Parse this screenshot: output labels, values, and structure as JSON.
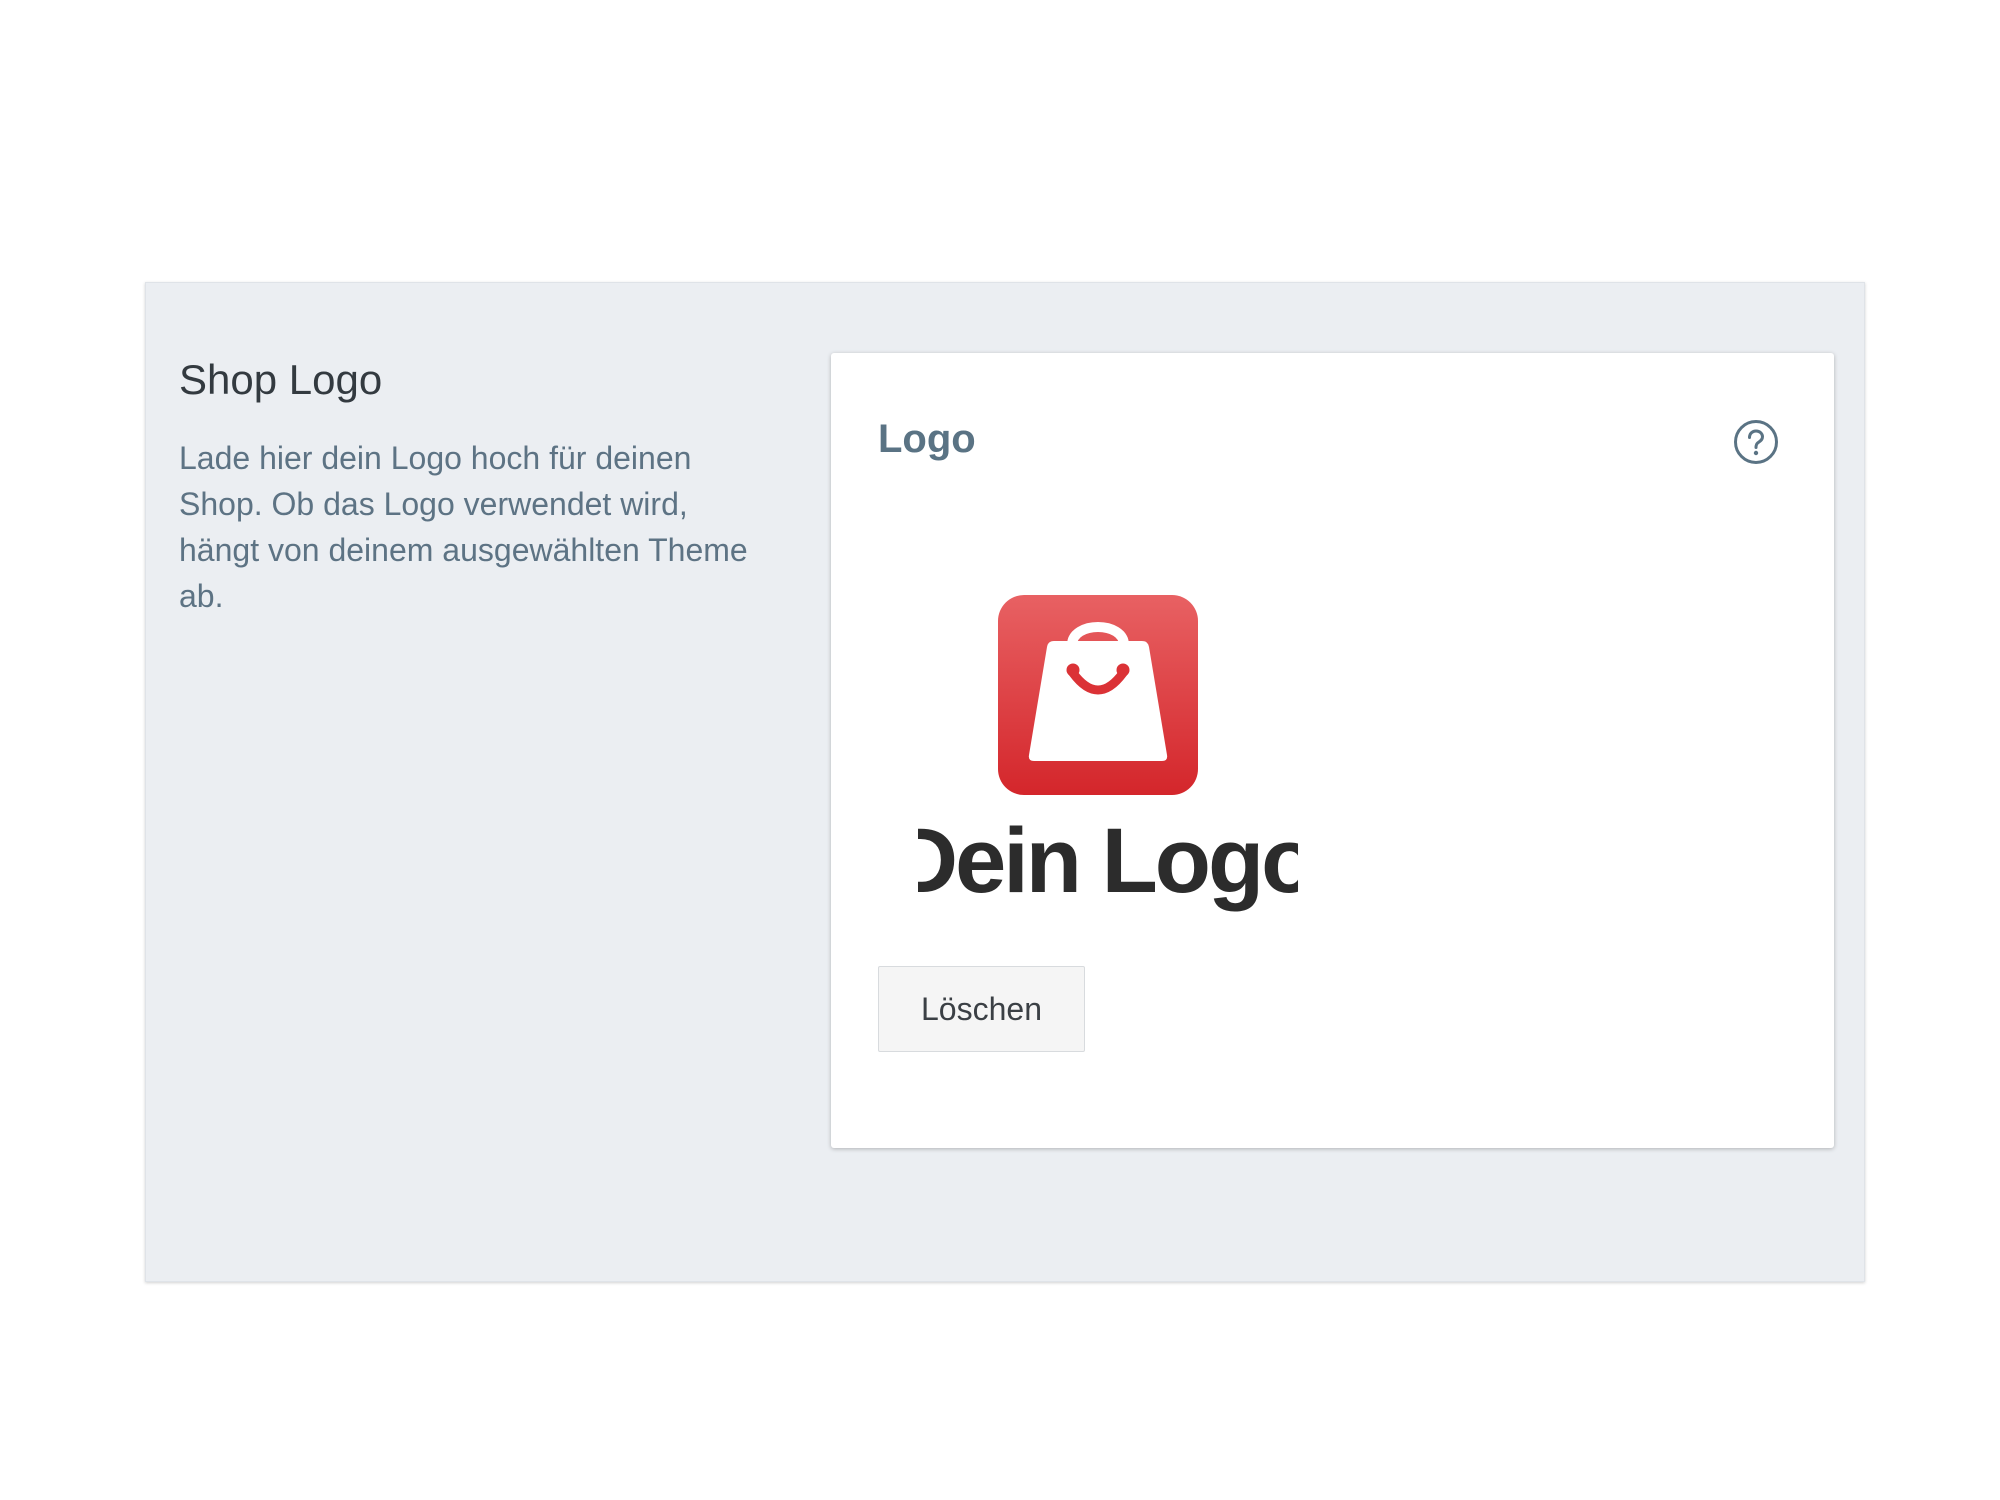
{
  "section": {
    "title": "Shop Logo",
    "description": "Lade hier dein Logo hoch für deinen Shop. Ob das Logo verwendet wird, hängt von deinem ausgewählten Theme ab."
  },
  "card": {
    "title": "Logo",
    "help_icon": "question-circle-icon",
    "logo_preview": {
      "icon": "shopping-bag-icon",
      "text": "Dein Logo",
      "brand_color": "#db3236",
      "text_color": "#2c2c2c"
    },
    "delete_label": "Löschen"
  },
  "colors": {
    "section_bg": "#ebeef2",
    "card_bg": "#ffffff",
    "title_text": "#5a7384",
    "description_text": "#5d7384"
  }
}
